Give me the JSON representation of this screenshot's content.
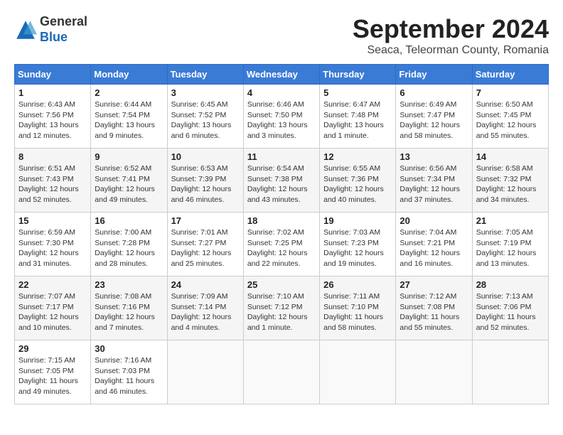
{
  "header": {
    "logo_line1": "General",
    "logo_line2": "Blue",
    "month_title": "September 2024",
    "location": "Seaca, Teleorman County, Romania"
  },
  "calendar": {
    "headers": [
      "Sunday",
      "Monday",
      "Tuesday",
      "Wednesday",
      "Thursday",
      "Friday",
      "Saturday"
    ],
    "weeks": [
      [
        {
          "day": "1",
          "content": "Sunrise: 6:43 AM\nSunset: 7:56 PM\nDaylight: 13 hours and 12 minutes."
        },
        {
          "day": "2",
          "content": "Sunrise: 6:44 AM\nSunset: 7:54 PM\nDaylight: 13 hours and 9 minutes."
        },
        {
          "day": "3",
          "content": "Sunrise: 6:45 AM\nSunset: 7:52 PM\nDaylight: 13 hours and 6 minutes."
        },
        {
          "day": "4",
          "content": "Sunrise: 6:46 AM\nSunset: 7:50 PM\nDaylight: 13 hours and 3 minutes."
        },
        {
          "day": "5",
          "content": "Sunrise: 6:47 AM\nSunset: 7:48 PM\nDaylight: 13 hours and 1 minute."
        },
        {
          "day": "6",
          "content": "Sunrise: 6:49 AM\nSunset: 7:47 PM\nDaylight: 12 hours and 58 minutes."
        },
        {
          "day": "7",
          "content": "Sunrise: 6:50 AM\nSunset: 7:45 PM\nDaylight: 12 hours and 55 minutes."
        }
      ],
      [
        {
          "day": "8",
          "content": "Sunrise: 6:51 AM\nSunset: 7:43 PM\nDaylight: 12 hours and 52 minutes."
        },
        {
          "day": "9",
          "content": "Sunrise: 6:52 AM\nSunset: 7:41 PM\nDaylight: 12 hours and 49 minutes."
        },
        {
          "day": "10",
          "content": "Sunrise: 6:53 AM\nSunset: 7:39 PM\nDaylight: 12 hours and 46 minutes."
        },
        {
          "day": "11",
          "content": "Sunrise: 6:54 AM\nSunset: 7:38 PM\nDaylight: 12 hours and 43 minutes."
        },
        {
          "day": "12",
          "content": "Sunrise: 6:55 AM\nSunset: 7:36 PM\nDaylight: 12 hours and 40 minutes."
        },
        {
          "day": "13",
          "content": "Sunrise: 6:56 AM\nSunset: 7:34 PM\nDaylight: 12 hours and 37 minutes."
        },
        {
          "day": "14",
          "content": "Sunrise: 6:58 AM\nSunset: 7:32 PM\nDaylight: 12 hours and 34 minutes."
        }
      ],
      [
        {
          "day": "15",
          "content": "Sunrise: 6:59 AM\nSunset: 7:30 PM\nDaylight: 12 hours and 31 minutes."
        },
        {
          "day": "16",
          "content": "Sunrise: 7:00 AM\nSunset: 7:28 PM\nDaylight: 12 hours and 28 minutes."
        },
        {
          "day": "17",
          "content": "Sunrise: 7:01 AM\nSunset: 7:27 PM\nDaylight: 12 hours and 25 minutes."
        },
        {
          "day": "18",
          "content": "Sunrise: 7:02 AM\nSunset: 7:25 PM\nDaylight: 12 hours and 22 minutes."
        },
        {
          "day": "19",
          "content": "Sunrise: 7:03 AM\nSunset: 7:23 PM\nDaylight: 12 hours and 19 minutes."
        },
        {
          "day": "20",
          "content": "Sunrise: 7:04 AM\nSunset: 7:21 PM\nDaylight: 12 hours and 16 minutes."
        },
        {
          "day": "21",
          "content": "Sunrise: 7:05 AM\nSunset: 7:19 PM\nDaylight: 12 hours and 13 minutes."
        }
      ],
      [
        {
          "day": "22",
          "content": "Sunrise: 7:07 AM\nSunset: 7:17 PM\nDaylight: 12 hours and 10 minutes."
        },
        {
          "day": "23",
          "content": "Sunrise: 7:08 AM\nSunset: 7:16 PM\nDaylight: 12 hours and 7 minutes."
        },
        {
          "day": "24",
          "content": "Sunrise: 7:09 AM\nSunset: 7:14 PM\nDaylight: 12 hours and 4 minutes."
        },
        {
          "day": "25",
          "content": "Sunrise: 7:10 AM\nSunset: 7:12 PM\nDaylight: 12 hours and 1 minute."
        },
        {
          "day": "26",
          "content": "Sunrise: 7:11 AM\nSunset: 7:10 PM\nDaylight: 11 hours and 58 minutes."
        },
        {
          "day": "27",
          "content": "Sunrise: 7:12 AM\nSunset: 7:08 PM\nDaylight: 11 hours and 55 minutes."
        },
        {
          "day": "28",
          "content": "Sunrise: 7:13 AM\nSunset: 7:06 PM\nDaylight: 11 hours and 52 minutes."
        }
      ],
      [
        {
          "day": "29",
          "content": "Sunrise: 7:15 AM\nSunset: 7:05 PM\nDaylight: 11 hours and 49 minutes."
        },
        {
          "day": "30",
          "content": "Sunrise: 7:16 AM\nSunset: 7:03 PM\nDaylight: 11 hours and 46 minutes."
        },
        {
          "day": "",
          "content": ""
        },
        {
          "day": "",
          "content": ""
        },
        {
          "day": "",
          "content": ""
        },
        {
          "day": "",
          "content": ""
        },
        {
          "day": "",
          "content": ""
        }
      ]
    ]
  }
}
